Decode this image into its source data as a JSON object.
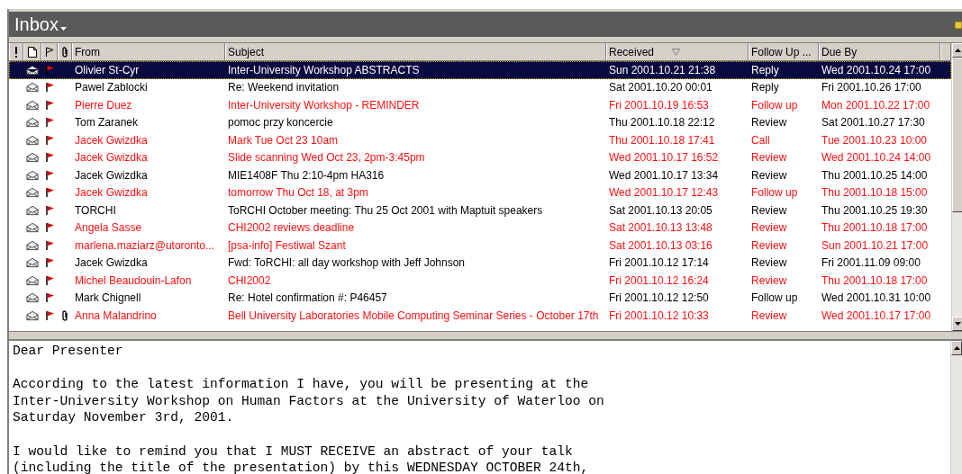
{
  "folder": {
    "title": "Inbox"
  },
  "table": {
    "columns": [
      {
        "kind": "importance"
      },
      {
        "kind": "icon"
      },
      {
        "kind": "flag"
      },
      {
        "kind": "attachment"
      },
      {
        "kind": "text",
        "label": "From"
      },
      {
        "kind": "text",
        "label": "Subject"
      },
      {
        "kind": "text",
        "label": "Received",
        "sorted": true
      },
      {
        "kind": "text",
        "label": "Follow Up ..."
      },
      {
        "kind": "text",
        "label": "Due By"
      },
      {
        "kind": "cut"
      }
    ],
    "rows": [
      {
        "from": "Olivier St-Cyr",
        "subject": "Inter-University Workshop ABSTRACTS",
        "received": "Sun 2001.10.21 21:38",
        "follow_up": "Reply",
        "due_by": "Wed 2001.10.24 17:00",
        "selected": true,
        "overdue": false,
        "flagged": true,
        "attachment": false
      },
      {
        "from": "Pawel Zablocki",
        "subject": "Re: Weekend invitation",
        "received": "Sat 2001.10.20 00:01",
        "follow_up": "Reply",
        "due_by": "Fri 2001.10.26 17:00",
        "selected": false,
        "overdue": false,
        "flagged": true,
        "attachment": false
      },
      {
        "from": "Pierre Duez",
        "subject": "Inter-University Workshop - REMINDER",
        "received": "Fri 2001.10.19 16:53",
        "follow_up": "Follow up",
        "due_by": "Mon 2001.10.22 17:00",
        "selected": false,
        "overdue": true,
        "flagged": true,
        "attachment": false
      },
      {
        "from": "Tom Zaranek",
        "subject": "pomoc przy koncercie",
        "received": "Thu 2001.10.18 22:12",
        "follow_up": "Review",
        "due_by": "Sat 2001.10.27 17:30",
        "selected": false,
        "overdue": false,
        "flagged": true,
        "attachment": false
      },
      {
        "from": "Jacek Gwizdka",
        "subject": "Mark Tue Oct 23 10am",
        "received": "Thu 2001.10.18 17:41",
        "follow_up": "Call",
        "due_by": "Tue 2001.10.23 10:00",
        "selected": false,
        "overdue": true,
        "flagged": true,
        "attachment": false
      },
      {
        "from": "Jacek Gwizdka",
        "subject": "Slide scanning Wed Oct 23, 2pm-3:45pm",
        "received": "Wed 2001.10.17 16:52",
        "follow_up": "Review",
        "due_by": "Wed 2001.10.24 14:00",
        "selected": false,
        "overdue": true,
        "flagged": true,
        "attachment": false
      },
      {
        "from": "Jacek Gwizdka",
        "subject": "MIE1408F Thu 2:10-4pm HA316",
        "received": "Wed 2001.10.17 13:34",
        "follow_up": "Review",
        "due_by": "Thu 2001.10.25 14:00",
        "selected": false,
        "overdue": false,
        "flagged": true,
        "attachment": false
      },
      {
        "from": "Jacek Gwizdka",
        "subject": "tomorrow Thu Oct 18, at 3pm",
        "received": "Wed 2001.10.17 12:43",
        "follow_up": "Follow up",
        "due_by": "Thu 2001.10.18 15:00",
        "selected": false,
        "overdue": true,
        "flagged": true,
        "attachment": false
      },
      {
        "from": "TORCHI",
        "subject": "ToRCHI October meeting: Thu 25 Oct 2001 with Maptuit speakers",
        "received": "Sat 2001.10.13 20:05",
        "follow_up": "Review",
        "due_by": "Thu 2001.10.25 19:30",
        "selected": false,
        "overdue": false,
        "flagged": true,
        "attachment": false
      },
      {
        "from": "Angela Sasse",
        "subject": "CHI2002 reviews deadline",
        "received": "Sat 2001.10.13 13:48",
        "follow_up": "Review",
        "due_by": "Thu 2001.10.18 17:00",
        "selected": false,
        "overdue": true,
        "flagged": true,
        "attachment": false
      },
      {
        "from": "marlena.maziarz@utoronto...",
        "subject": "[psa-info] Festiwal Szant",
        "received": "Sat 2001.10.13 03:16",
        "follow_up": "Review",
        "due_by": "Sun 2001.10.21 17:00",
        "selected": false,
        "overdue": true,
        "flagged": true,
        "attachment": false
      },
      {
        "from": "Jacek Gwizdka",
        "subject": "Fwd: ToRCHI: all day workshop with Jeff Johnson",
        "received": "Fri 2001.10.12 17:14",
        "follow_up": "Review",
        "due_by": "Fri 2001.11.09 09:00",
        "selected": false,
        "overdue": false,
        "flagged": true,
        "attachment": false
      },
      {
        "from": "Michel Beaudouin-Lafon",
        "subject": "CHI2002",
        "received": "Fri 2001.10.12 16:24",
        "follow_up": "Review",
        "due_by": "Thu 2001.10.18 17:00",
        "selected": false,
        "overdue": true,
        "flagged": true,
        "attachment": false
      },
      {
        "from": "Mark Chignell",
        "subject": "Re: Hotel confirmation #: P46457",
        "received": "Fri 2001.10.12 12:50",
        "follow_up": "Follow up",
        "due_by": "Wed 2001.10.31 10:00",
        "selected": false,
        "overdue": false,
        "flagged": true,
        "attachment": false
      },
      {
        "from": "Anna Malandrino",
        "subject": "Bell University Laboratories Mobile Computing Seminar Series - October 17th",
        "received": "Fri 2001.10.12 10:33",
        "follow_up": "Review",
        "due_by": "Wed 2001.10.17 17:00",
        "selected": false,
        "overdue": true,
        "flagged": true,
        "attachment": true
      }
    ]
  },
  "preview": {
    "paragraphs": [
      [
        "Dear Presenter"
      ],
      [
        "According to the latest information I have, you will be presenting at the",
        "Inter-University Workshop on Human Factors at the University of Waterloo on",
        "Saturday November 3rd, 2001."
      ],
      [
        "I would like to remind you that I MUST RECEIVE an abstract of your talk",
        "(including the title of the presentation) by this WEDNESDAY OCTOBER 24th,"
      ]
    ]
  }
}
